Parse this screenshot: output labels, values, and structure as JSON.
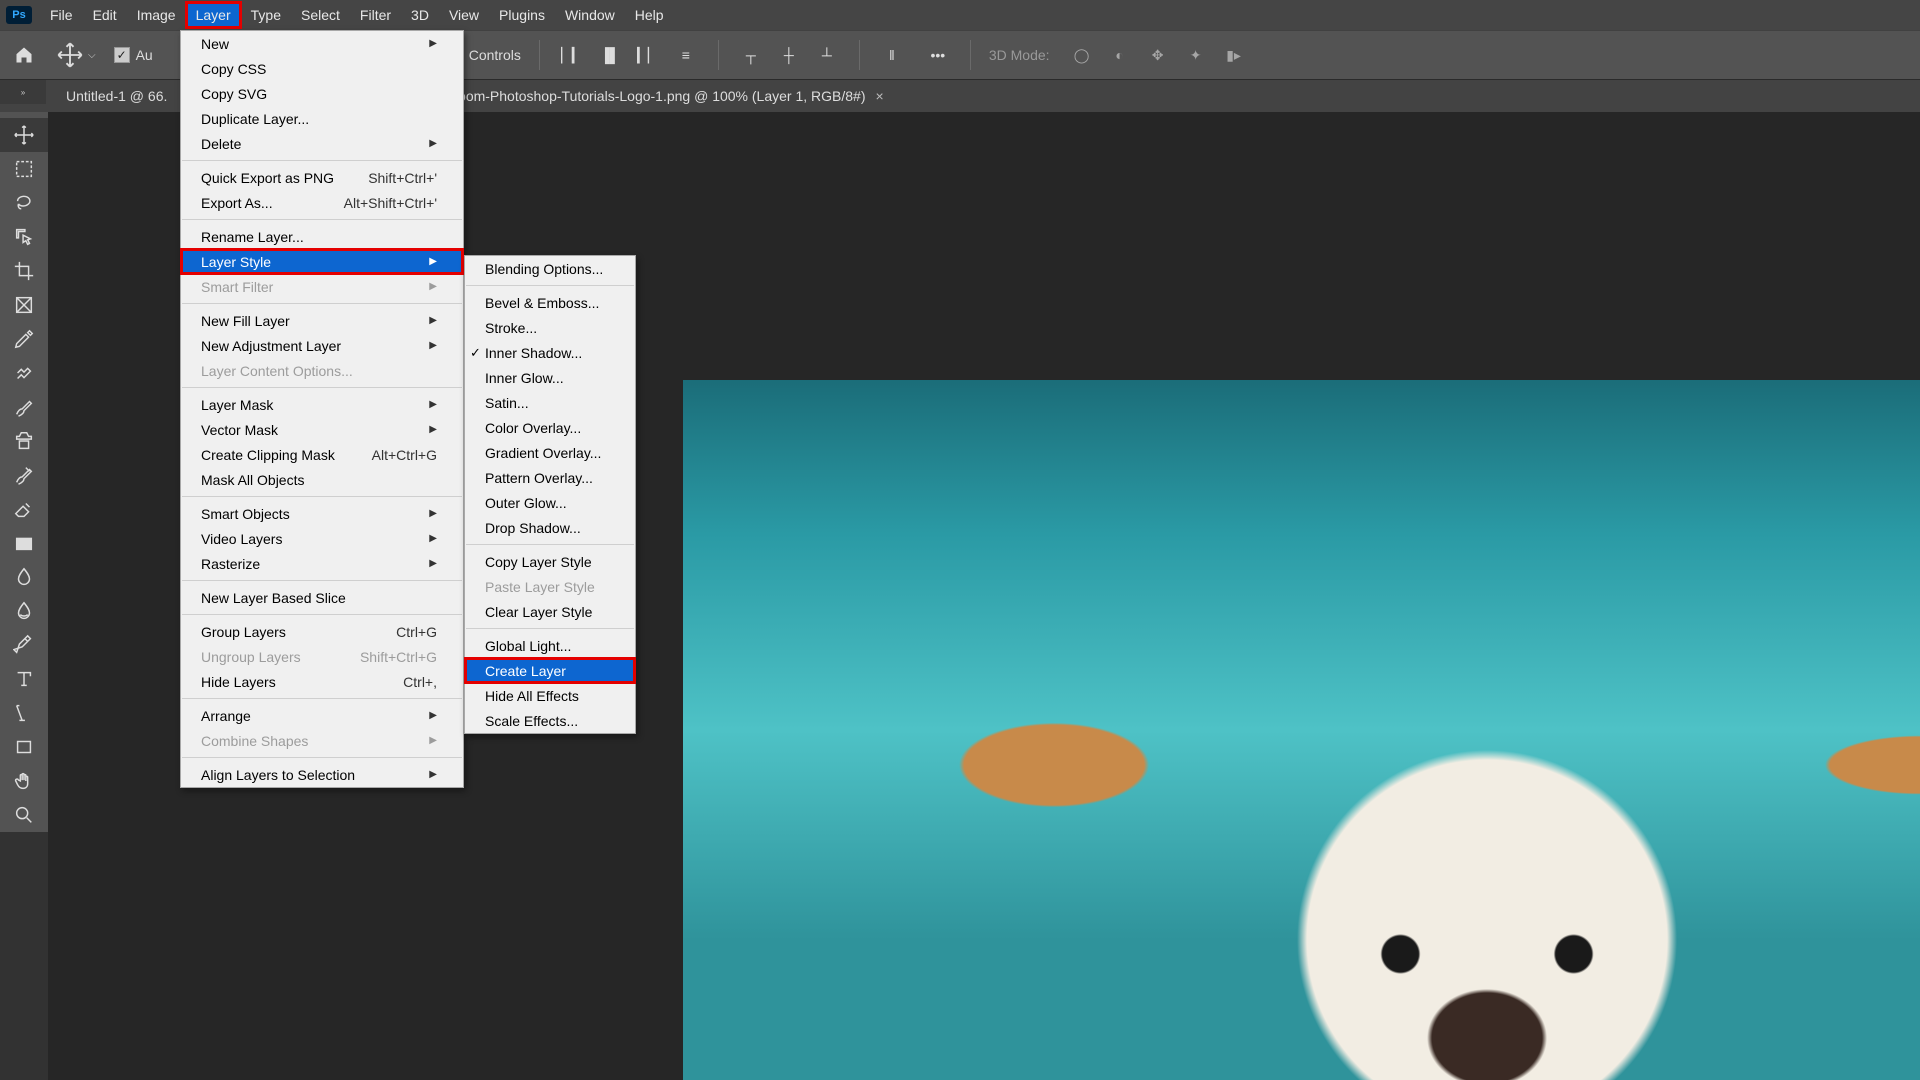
{
  "menubar": {
    "items": [
      "File",
      "Edit",
      "Image",
      "Layer",
      "Type",
      "Select",
      "Filter",
      "3D",
      "View",
      "Plugins",
      "Window",
      "Help"
    ],
    "open_index": 3
  },
  "optbar": {
    "auto_label": "Au",
    "controls_label": "Controls",
    "mode_label": "3D Mode:"
  },
  "tabs": [
    {
      "label": "Untitled-1 @ 66.",
      "close": true
    },
    {
      "label": "room-Photoshop-Tutorials-Logo-1.png @ 100% (Layer 1, RGB/8#)",
      "close": true
    }
  ],
  "layer_menu": [
    {
      "t": "item",
      "label": "New",
      "arrow": true
    },
    {
      "t": "item",
      "label": "Copy CSS"
    },
    {
      "t": "item",
      "label": "Copy SVG"
    },
    {
      "t": "item",
      "label": "Duplicate Layer..."
    },
    {
      "t": "item",
      "label": "Delete",
      "arrow": true
    },
    {
      "t": "sep"
    },
    {
      "t": "item",
      "label": "Quick Export as PNG",
      "shortcut": "Shift+Ctrl+'"
    },
    {
      "t": "item",
      "label": "Export As...",
      "shortcut": "Alt+Shift+Ctrl+'"
    },
    {
      "t": "sep"
    },
    {
      "t": "item",
      "label": "Rename Layer..."
    },
    {
      "t": "item",
      "label": "Layer Style",
      "arrow": true,
      "selected": true,
      "redbox": true
    },
    {
      "t": "item",
      "label": "Smart Filter",
      "arrow": true,
      "disabled": true
    },
    {
      "t": "sep"
    },
    {
      "t": "item",
      "label": "New Fill Layer",
      "arrow": true
    },
    {
      "t": "item",
      "label": "New Adjustment Layer",
      "arrow": true
    },
    {
      "t": "item",
      "label": "Layer Content Options...",
      "disabled": true
    },
    {
      "t": "sep"
    },
    {
      "t": "item",
      "label": "Layer Mask",
      "arrow": true
    },
    {
      "t": "item",
      "label": "Vector Mask",
      "arrow": true
    },
    {
      "t": "item",
      "label": "Create Clipping Mask",
      "shortcut": "Alt+Ctrl+G"
    },
    {
      "t": "item",
      "label": "Mask All Objects"
    },
    {
      "t": "sep"
    },
    {
      "t": "item",
      "label": "Smart Objects",
      "arrow": true
    },
    {
      "t": "item",
      "label": "Video Layers",
      "arrow": true
    },
    {
      "t": "item",
      "label": "Rasterize",
      "arrow": true
    },
    {
      "t": "sep"
    },
    {
      "t": "item",
      "label": "New Layer Based Slice"
    },
    {
      "t": "sep"
    },
    {
      "t": "item",
      "label": "Group Layers",
      "shortcut": "Ctrl+G"
    },
    {
      "t": "item",
      "label": "Ungroup Layers",
      "shortcut": "Shift+Ctrl+G",
      "disabled": true
    },
    {
      "t": "item",
      "label": "Hide Layers",
      "shortcut": "Ctrl+,"
    },
    {
      "t": "sep"
    },
    {
      "t": "item",
      "label": "Arrange",
      "arrow": true
    },
    {
      "t": "item",
      "label": "Combine Shapes",
      "arrow": true,
      "disabled": true
    },
    {
      "t": "sep"
    },
    {
      "t": "item",
      "label": "Align Layers to Selection",
      "arrow": true
    }
  ],
  "style_menu": [
    {
      "t": "item",
      "label": "Blending Options..."
    },
    {
      "t": "sep"
    },
    {
      "t": "item",
      "label": "Bevel & Emboss..."
    },
    {
      "t": "item",
      "label": "Stroke..."
    },
    {
      "t": "item",
      "label": "Inner Shadow...",
      "checked": true
    },
    {
      "t": "item",
      "label": "Inner Glow..."
    },
    {
      "t": "item",
      "label": "Satin..."
    },
    {
      "t": "item",
      "label": "Color Overlay..."
    },
    {
      "t": "item",
      "label": "Gradient Overlay..."
    },
    {
      "t": "item",
      "label": "Pattern Overlay..."
    },
    {
      "t": "item",
      "label": "Outer Glow..."
    },
    {
      "t": "item",
      "label": "Drop Shadow..."
    },
    {
      "t": "sep"
    },
    {
      "t": "item",
      "label": "Copy Layer Style"
    },
    {
      "t": "item",
      "label": "Paste Layer Style",
      "disabled": true
    },
    {
      "t": "item",
      "label": "Clear Layer Style"
    },
    {
      "t": "sep"
    },
    {
      "t": "item",
      "label": "Global Light..."
    },
    {
      "t": "item",
      "label": "Create Layer",
      "selected": true,
      "redbox": true
    },
    {
      "t": "item",
      "label": "Hide All Effects"
    },
    {
      "t": "item",
      "label": "Scale Effects..."
    }
  ],
  "tools": [
    "move",
    "marquee",
    "lasso",
    "object-select",
    "crop",
    "frame",
    "eyedropper",
    "heal",
    "brush",
    "clone",
    "history",
    "eraser",
    "rectangle",
    "blur",
    "sharpen",
    "pen",
    "type",
    "path",
    "shape",
    "hand",
    "zoom"
  ]
}
